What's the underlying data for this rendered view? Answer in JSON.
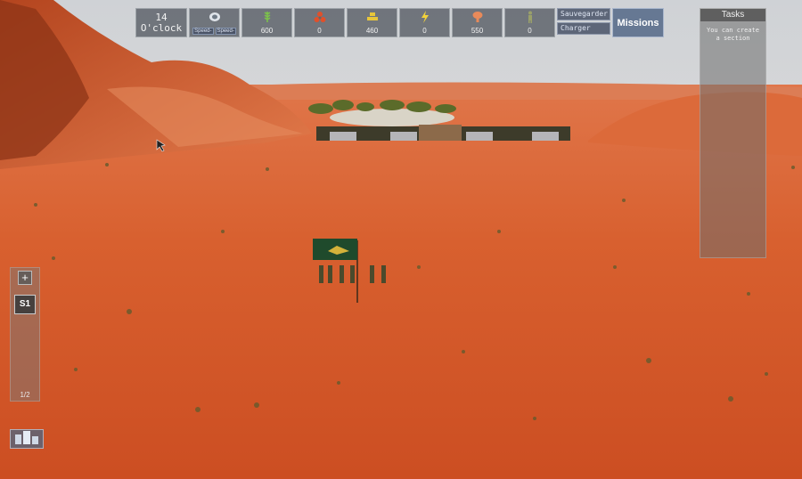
{
  "hud": {
    "clock_hour": "14",
    "clock_suffix": "O'clock",
    "speed_down_label": "Speed-",
    "speed_up_label": "Speed-",
    "resources": [
      {
        "icon": "wheat-icon",
        "value": "600"
      },
      {
        "icon": "biohazard-icon",
        "value": "0"
      },
      {
        "icon": "gold-bars-icon",
        "value": "460"
      },
      {
        "icon": "lightning-icon",
        "value": "0"
      },
      {
        "icon": "mushroom-cloud-icon",
        "value": "550"
      },
      {
        "icon": "soldier-icon",
        "value": "0"
      }
    ],
    "save_label": "Sauvegarder",
    "load_label": "Charger",
    "missions_label": "Missions"
  },
  "tasks": {
    "title": "Tasks",
    "items": [
      "You can create a section"
    ]
  },
  "left_panel": {
    "add_label": "+",
    "section_label": "S1",
    "page_label": "1/2"
  },
  "colors": {
    "sand": "#d6582c",
    "sky": "#e6e2dc",
    "flag_green": "#1f4a2c"
  }
}
